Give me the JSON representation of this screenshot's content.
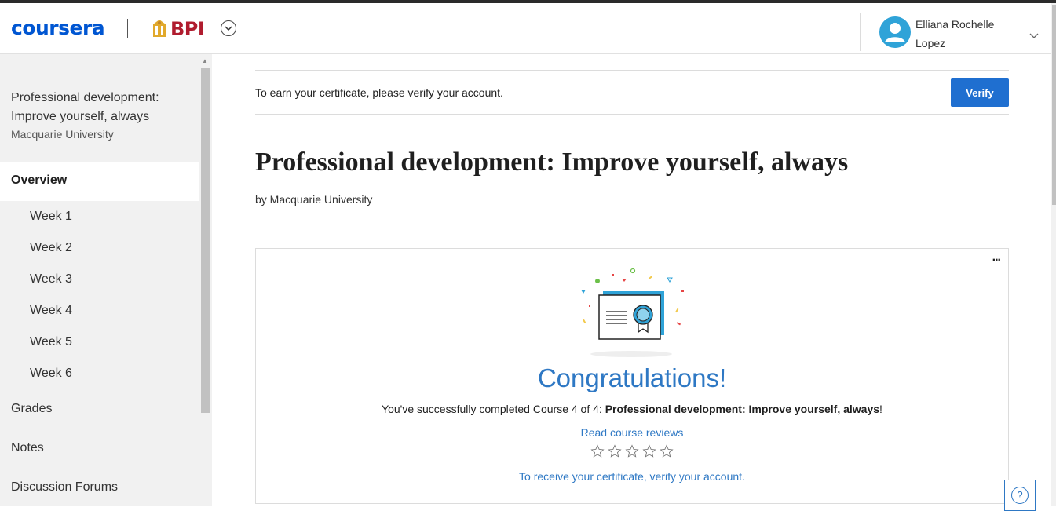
{
  "header": {
    "logo_text": "coursera",
    "org_logo_text": "BPI",
    "user_name": "Elliana Rochelle Lopez"
  },
  "sidebar": {
    "course_title": "Professional development: Improve yourself, always",
    "course_org": "Macquarie University",
    "overview_label": "Overview",
    "weeks": [
      "Week 1",
      "Week 2",
      "Week 3",
      "Week 4",
      "Week 5",
      "Week 6"
    ],
    "grades_label": "Grades",
    "notes_label": "Notes",
    "forums_label": "Discussion Forums"
  },
  "verify_banner": {
    "text": "To earn your certificate, please verify your account.",
    "button_label": "Verify"
  },
  "main": {
    "title": "Professional development: Improve yourself, always",
    "by_line": "by Macquarie University"
  },
  "card": {
    "more_label": "...",
    "congrats": "Congratulations!",
    "completed_prefix": "You've successfully completed Course 4 of 4: ",
    "completed_course": "Professional development: Improve yourself, always",
    "completed_suffix": "!",
    "reviews_link": "Read course reviews",
    "rating_stars": 5,
    "receive_link": "To receive your certificate, verify your account."
  },
  "colors": {
    "brand_blue": "#0056d2",
    "link_blue": "#2e78c4",
    "button_blue": "#1f6fd0",
    "bpi_red": "#b01c2e"
  },
  "icons": [
    "chevron-down-icon",
    "user-avatar-icon",
    "certificate-icon",
    "star-icon",
    "help-icon",
    "more-icon"
  ]
}
